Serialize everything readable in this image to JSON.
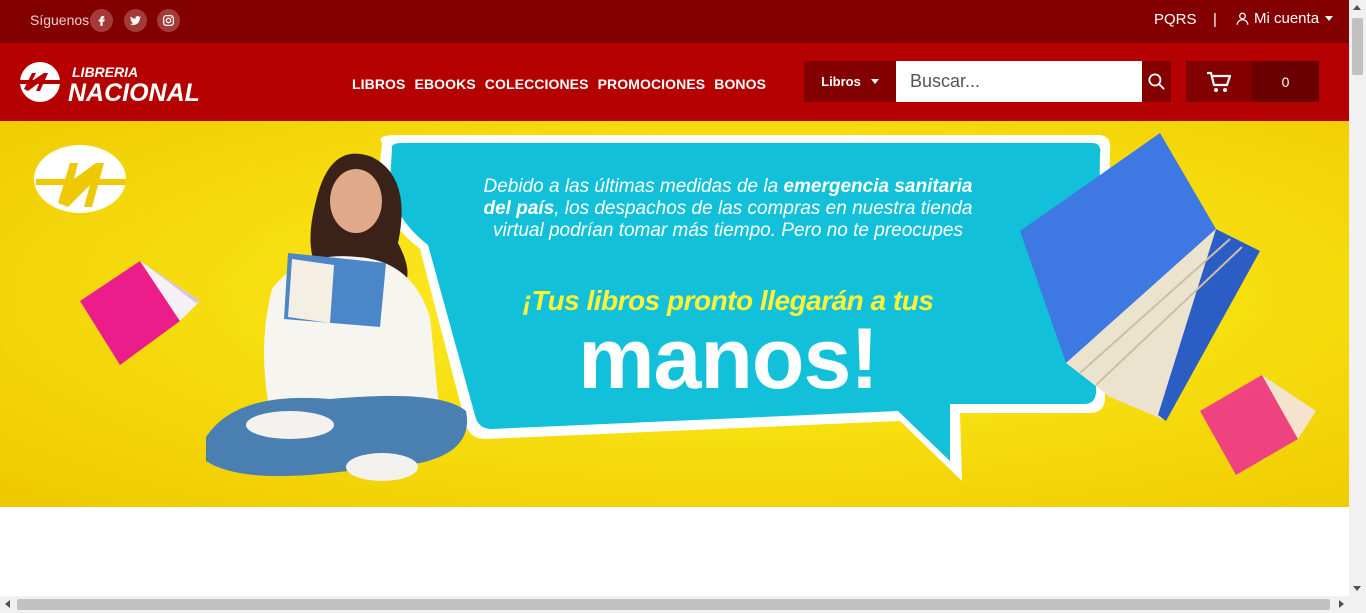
{
  "topbar": {
    "follow_label": "Síguenos",
    "social": [
      "facebook-icon",
      "twitter-icon",
      "instagram-icon"
    ],
    "pqrs": "PQRS",
    "separator": "|",
    "account": "Mi cuenta"
  },
  "header": {
    "logo_line1": "LIBRERIA",
    "logo_line2": "NACIONAL",
    "nav": [
      "LIBROS",
      "EBOOKS",
      "COLECCIONES",
      "PROMOCIONES",
      "BONOS"
    ],
    "category": "Libros",
    "search_placeholder": "Buscar...",
    "cart_count": "0"
  },
  "banner": {
    "msg_part1": "Debido a las últimas medidas de la ",
    "msg_bold": "emergencia sanitaria del país",
    "msg_part2": ", los despachos de las compras en nuestra tienda virtual podrían tomar más tiempo. Pero no te preocupes",
    "slogan": "¡Tus libros pronto llegarán a tus",
    "big": "manos!"
  },
  "colors": {
    "topbar": "#830000",
    "header": "#b50000",
    "banner_yellow": "#f7df10",
    "bubble": "#12c1d9"
  }
}
